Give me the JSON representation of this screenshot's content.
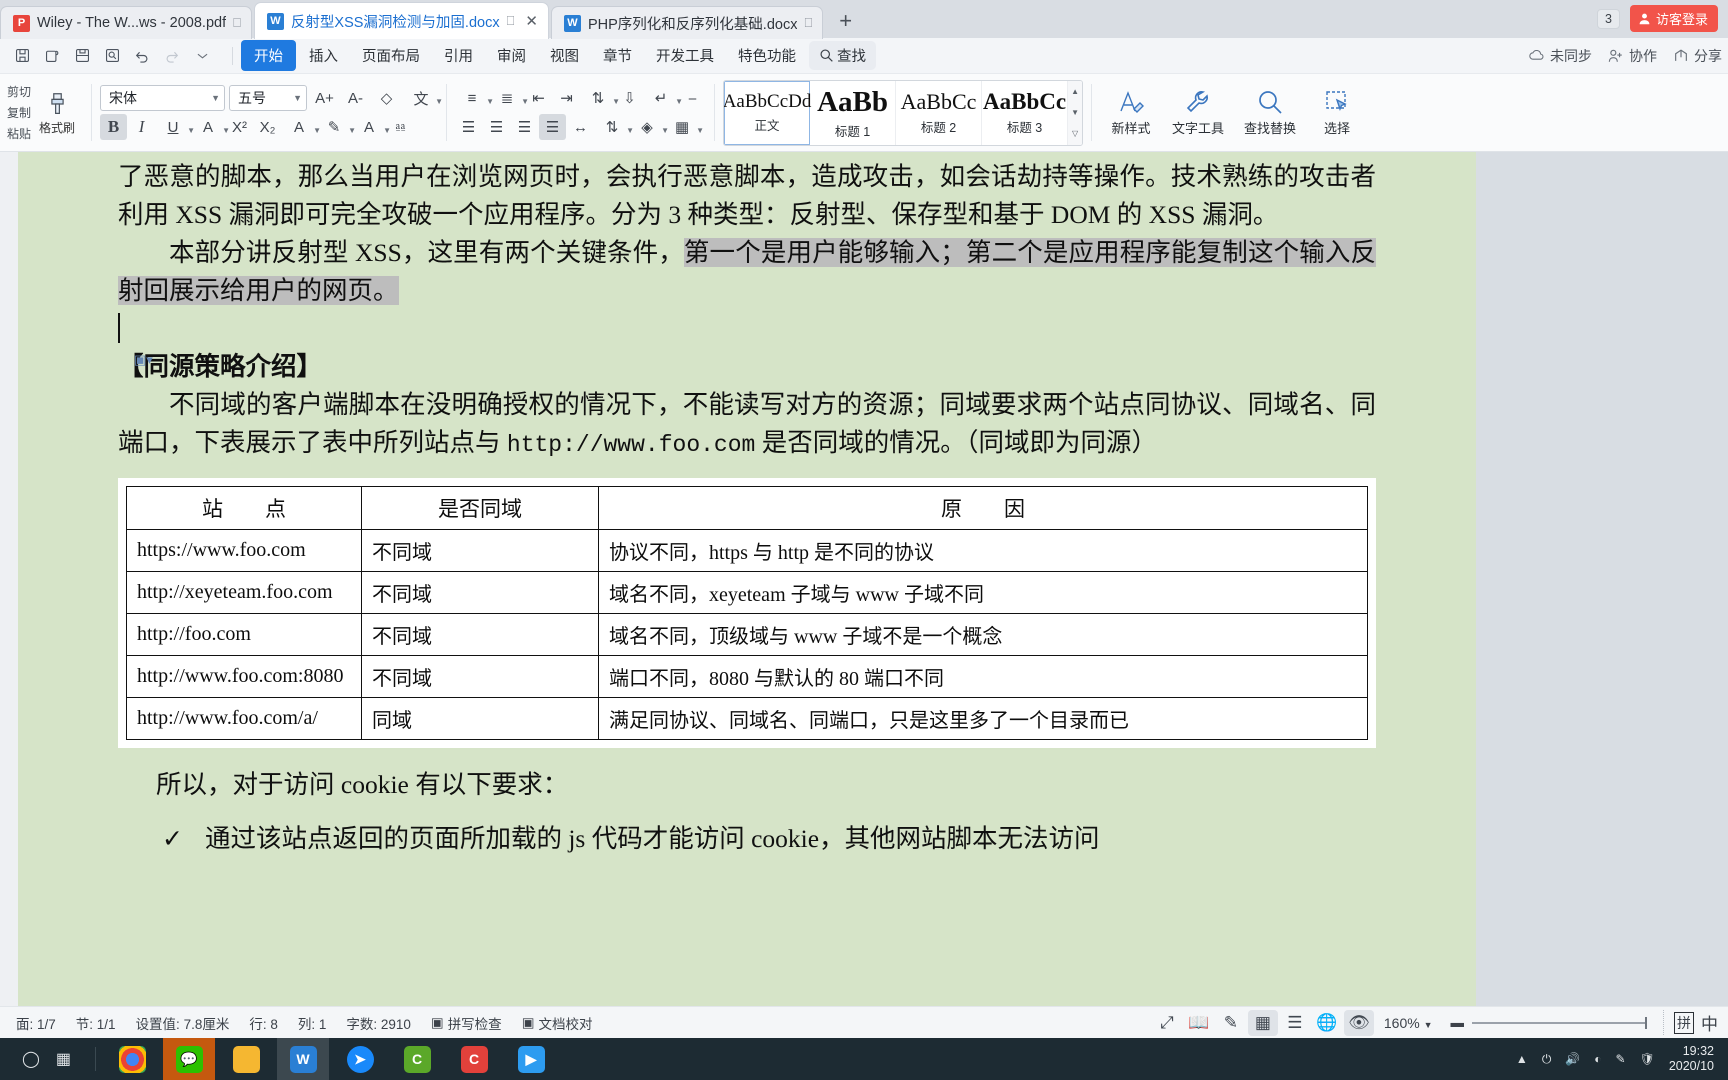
{
  "tabs": [
    {
      "label": "Wiley - The W...ws - 2008.pdf",
      "type": "pdf",
      "active": false
    },
    {
      "label": "反射型XSS漏洞检测与加固.docx",
      "type": "doc",
      "active": true
    },
    {
      "label": "PHP序列化和反序列化基础.docx",
      "type": "doc",
      "active": false
    }
  ],
  "tabbar": {
    "new_tab_label": "+",
    "badge_count": "3",
    "login_label": "访客登录"
  },
  "menubar": {
    "items": [
      "开始",
      "插入",
      "页面布局",
      "引用",
      "审阅",
      "视图",
      "章节",
      "开发工具",
      "特色功能"
    ],
    "active": "开始",
    "find_label": "查找",
    "right_items": [
      "未同步",
      "协作",
      "分享"
    ]
  },
  "ribbon": {
    "clipboard": {
      "cut": "剪切",
      "copy": "复制",
      "paste": "粘贴",
      "format_painter": "格式刷"
    },
    "font": {
      "family": "宋体",
      "size": "五号",
      "grow_label": "A+",
      "shrink_label": "A-",
      "bold": "B",
      "italic": "I",
      "underline": "U"
    },
    "styles": [
      {
        "preview": "AaBbCcDd",
        "name": "正文",
        "selected": true
      },
      {
        "preview": "AaBb",
        "name": "标题 1",
        "selected": false
      },
      {
        "preview": "AaBbCc",
        "name": "标题 2",
        "selected": false
      },
      {
        "preview": "AaBbCc",
        "name": "标题 3",
        "selected": false
      }
    ],
    "buttons": [
      {
        "label": "新样式",
        "icon": "new-style-icon"
      },
      {
        "label": "文字工具",
        "icon": "wrench-icon"
      },
      {
        "label": "查找替换",
        "icon": "search-icon"
      },
      {
        "label": "选择",
        "icon": "select-icon"
      }
    ]
  },
  "document": {
    "paragraphs": [
      "了恶意的脚本，那么当用户在浏览网页时，会执行恶意脚本，造成攻击，如会话劫持等操作。技术熟练的攻击者利用 XSS 漏洞即可完全攻破一个应用程序。分为 3 种类型：反射型、保存型和基于 DOM 的 XSS 漏洞。"
    ],
    "p2_plain": "本部分讲反射型 XSS，这里有两个关键条件，",
    "p2_highlight": "第一个是用户能够输入；第二个是应用程序能复制这个输入反射回展示给用户的网页。",
    "heading": "【同源策略介绍】",
    "p3_a": "不同域的客户端脚本在没明确授权的情况下，不能读写对方的资源；同域要求两个站点同协议、同域名、同端口，下表展示了表中所列站点与 ",
    "p3_url": "http://www.foo.com",
    "p3_b": " 是否同域的情况。（同域即为同源）",
    "p4": "所以，对于访问 cookie 有以下要求：",
    "bullet1": "通过该站点返回的页面所加载的 js 代码才能访问 cookie，其他网站脚本无法访问",
    "bullet1_mark": "✓"
  },
  "table": {
    "headers": [
      "站　　点",
      "是否同域",
      "原　　因"
    ],
    "rows": [
      [
        "https://www.foo.com",
        "不同域",
        "协议不同，https 与 http 是不同的协议"
      ],
      [
        "http://xeyeteam.foo.com",
        "不同域",
        "域名不同，xeyeteam 子域与 www 子域不同"
      ],
      [
        "http://foo.com",
        "不同域",
        "域名不同，顶级域与 www 子域不是一个概念"
      ],
      [
        "http://www.foo.com:8080",
        "不同域",
        "端口不同，8080 与默认的 80 端口不同"
      ],
      [
        "http://www.foo.com/a/",
        "同域",
        "满足同协议、同域名、同端口，只是这里多了一个目录而已"
      ]
    ]
  },
  "statusbar": {
    "page": "面: 1/7",
    "section": "节: 1/1",
    "setting": "设置值: 7.8厘米",
    "line": "行: 8",
    "col": "列: 1",
    "words": "字数: 2910",
    "spellcheck": "拼写检查",
    "proofread": "文档校对",
    "zoom": "160%",
    "ime_pinyin": "拼",
    "ime_mode": "中"
  },
  "taskbar": {
    "apps": [
      "chrome",
      "wechat",
      "explorer",
      "wps",
      "dingtalk",
      "evernote",
      "camtasia",
      "player"
    ],
    "clock_time": "19:32",
    "clock_date": "2020/10"
  }
}
